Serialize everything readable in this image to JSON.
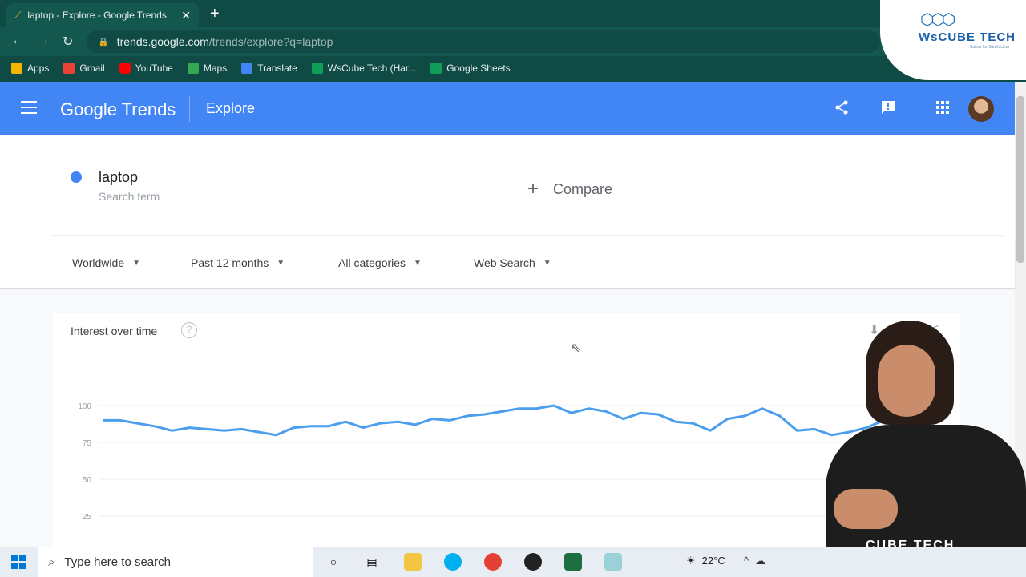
{
  "browser": {
    "tab_title": "laptop - Explore - Google Trends",
    "tab_close": "✕",
    "new_tab": "+",
    "url_domain": "trends.google.com",
    "url_path": "/trends/explore?q=laptop",
    "bookmarks": [
      {
        "label": "Apps",
        "color": "#f4b400"
      },
      {
        "label": "Gmail",
        "color": "#ea4335"
      },
      {
        "label": "YouTube",
        "color": "#ff0000"
      },
      {
        "label": "Maps",
        "color": "#34a853"
      },
      {
        "label": "Translate",
        "color": "#4285f4"
      },
      {
        "label": "WsCube Tech (Har...",
        "color": "#0f9d58"
      },
      {
        "label": "Google Sheets",
        "color": "#0f9d58"
      }
    ]
  },
  "overlay_logo": {
    "name": "WsCube Tech",
    "tagline": "Sutras for Satisfaction"
  },
  "header": {
    "brand": "Google Trends",
    "section": "Explore"
  },
  "search": {
    "term": "laptop",
    "term_type": "Search term",
    "compare_label": "Compare",
    "term_color": "#4285f4"
  },
  "filters": [
    {
      "label": "Worldwide"
    },
    {
      "label": "Past 12 months"
    },
    {
      "label": "All categories"
    },
    {
      "label": "Web Search"
    }
  ],
  "chart_card": {
    "title": "Interest over time",
    "help": "?"
  },
  "chart_data": {
    "type": "line",
    "title": "Interest over time",
    "xlabel": "",
    "ylabel": "",
    "ylim": [
      0,
      100
    ],
    "yticks": [
      100,
      75,
      50,
      25
    ],
    "grid": true,
    "series": [
      {
        "color": "#4a9eed",
        "values": [
          90,
          90,
          88,
          86,
          83,
          85,
          84,
          83,
          84,
          82,
          80,
          85,
          86,
          86,
          89,
          85,
          88,
          89,
          87,
          91,
          90,
          93,
          94,
          96,
          98,
          98,
          100,
          95,
          98,
          96,
          91,
          95,
          94,
          89,
          88,
          83,
          91,
          93,
          98,
          93,
          83,
          84,
          80,
          82,
          85,
          90,
          91,
          86
        ]
      }
    ]
  },
  "presenter_shirt_text": "CUBE TECH",
  "taskbar": {
    "search_placeholder": "Type here to search",
    "temperature": "22°C"
  }
}
